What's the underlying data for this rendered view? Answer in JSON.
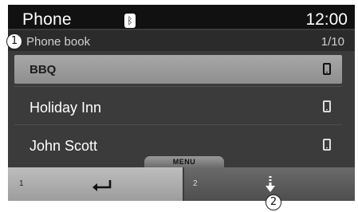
{
  "header": {
    "title": "Phone",
    "bluetooth_icon": "bluetooth-icon",
    "clock": "12:00"
  },
  "subheader": {
    "callout": "1",
    "title": "Phone book",
    "page": "1/10"
  },
  "contacts": [
    {
      "name": "BBQ",
      "icon": "mobile-phone-icon",
      "selected": true
    },
    {
      "name": "Holiday Inn",
      "icon": "mobile-phone-icon",
      "selected": false
    },
    {
      "name": "John Scott",
      "icon": "mobile-phone-icon",
      "selected": false
    }
  ],
  "menu": {
    "label": "MENU"
  },
  "buttons": [
    {
      "number": "1",
      "icon": "back-arrow-icon"
    },
    {
      "number": "2",
      "icon": "download-arrow-icon"
    }
  ],
  "callout2": "2",
  "colors": {
    "panel": "#3b3b3b",
    "titlebar": "#111111",
    "selected_row": "#9c9c9c"
  }
}
